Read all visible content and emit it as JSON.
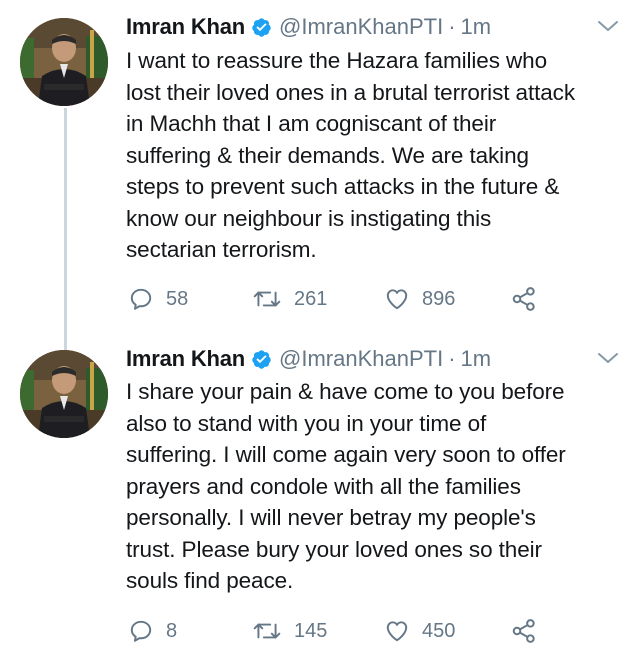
{
  "tweets": [
    {
      "name": "Imran Khan",
      "handle": "@ImranKhanPTI",
      "separator": "·",
      "time": "1m",
      "lines": [
        "I want to reassure the Hazara families who",
        "lost their loved ones in a brutal terrorist attack",
        "in Machh that I am cogniscant of their",
        "suffering & their demands. We are taking",
        "steps to prevent such attacks in the future &",
        "know our neighbour is instigating this",
        "sectarian terrorism."
      ],
      "replies": "58",
      "retweets": "261",
      "likes": "896"
    },
    {
      "name": "Imran Khan",
      "handle": "@ImranKhanPTI",
      "separator": "·",
      "time": "1m",
      "lines": [
        "I share your pain & have come to you before",
        "also to stand with you in your time of",
        "suffering. I will come again very soon to offer",
        "prayers and condole with all the families",
        "personally. I will never betray my people's",
        "trust. Please bury your loved ones so their",
        "souls find peace."
      ],
      "replies": "8",
      "retweets": "145",
      "likes": "450"
    }
  ],
  "icons": {
    "verified": "verified-badge-icon",
    "caret": "chevron-down-icon",
    "reply": "reply-icon",
    "retweet": "retweet-icon",
    "like": "heart-icon",
    "share": "share-icon"
  },
  "colors": {
    "text": "#14171a",
    "secondary": "#657786",
    "verified": "#1da1f2",
    "thread_line": "#ccd6dd"
  }
}
